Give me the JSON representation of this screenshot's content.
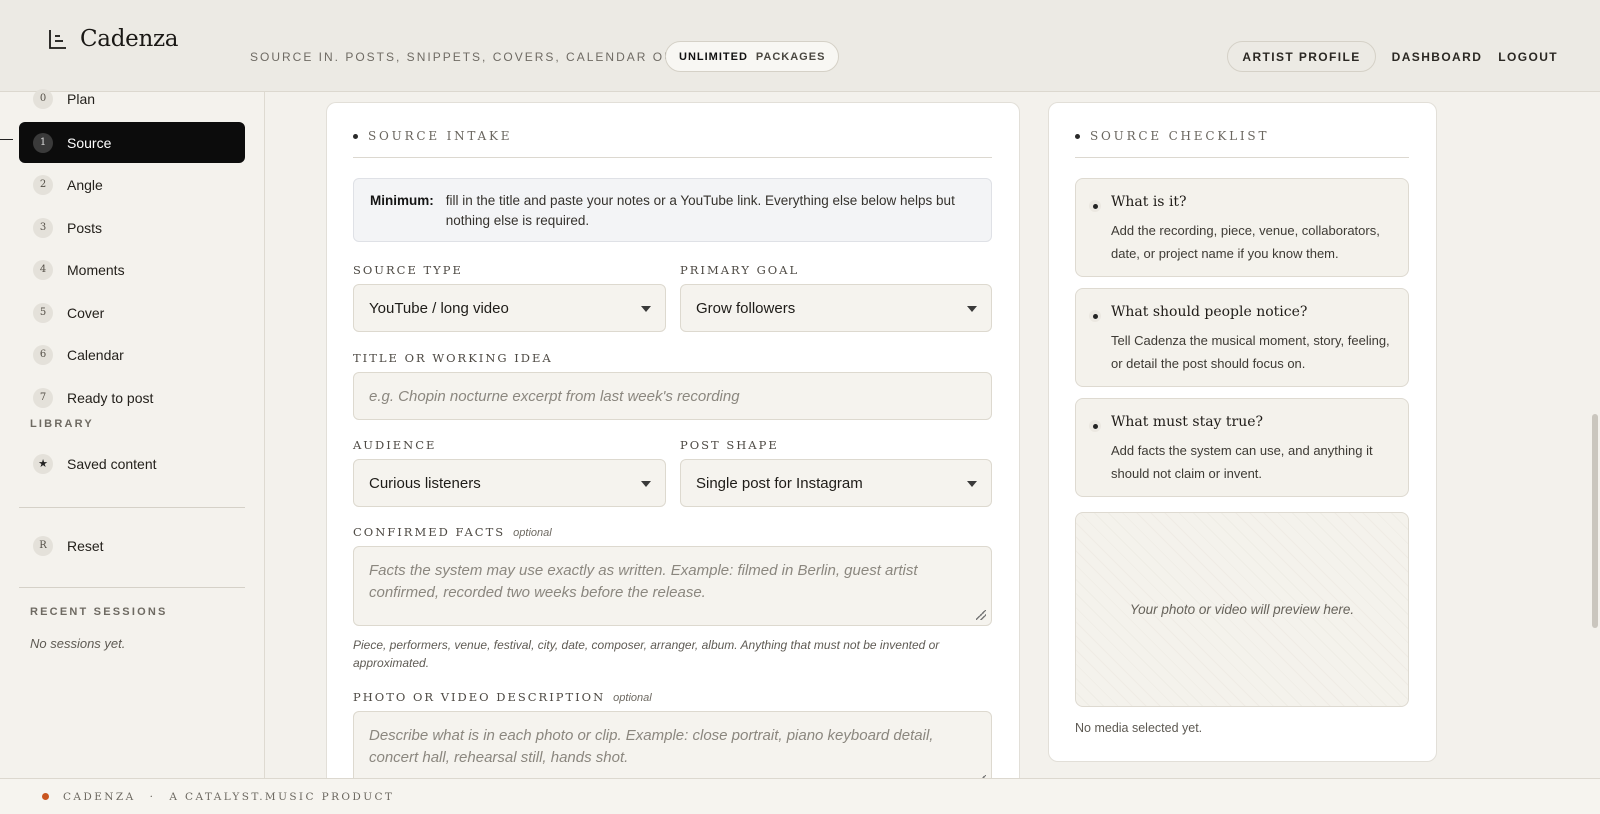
{
  "header": {
    "brand": "Cadenza",
    "tagline": "SOURCE IN. POSTS, SNIPPETS, COVERS, CALENDAR OUT.",
    "plan_pill": {
      "strong": "UNLIMITED",
      "rest": "PACKAGES"
    },
    "nav": {
      "profile": "ARTIST PROFILE",
      "dashboard": "DASHBOARD",
      "logout": "LOGOUT"
    }
  },
  "sidebar": {
    "steps": [
      {
        "num": "0",
        "label": "Plan"
      },
      {
        "num": "1",
        "label": "Source"
      },
      {
        "num": "2",
        "label": "Angle"
      },
      {
        "num": "3",
        "label": "Posts"
      },
      {
        "num": "4",
        "label": "Moments"
      },
      {
        "num": "5",
        "label": "Cover"
      },
      {
        "num": "6",
        "label": "Calendar"
      },
      {
        "num": "7",
        "label": "Ready to post"
      }
    ],
    "active_step": "Source",
    "library_heading": "LIBRARY",
    "saved": {
      "icon": "★",
      "label": "Saved content"
    },
    "reset": {
      "icon": "R",
      "label": "Reset"
    },
    "recent_heading": "RECENT SESSIONS",
    "recent_empty": "No sessions yet."
  },
  "intake": {
    "title": "SOURCE INTAKE",
    "minimum_label": "Minimum:",
    "minimum_text": "fill in the title and paste your notes or a YouTube link. Everything else below helps but nothing else is required.",
    "source_type": {
      "label": "SOURCE TYPE",
      "value": "YouTube / long video"
    },
    "primary_goal": {
      "label": "PRIMARY GOAL",
      "value": "Grow followers"
    },
    "title_field": {
      "label": "TITLE OR WORKING IDEA",
      "placeholder": "e.g. Chopin nocturne excerpt from last week's recording"
    },
    "audience": {
      "label": "AUDIENCE",
      "value": "Curious listeners"
    },
    "post_shape": {
      "label": "POST SHAPE",
      "value": "Single post for Instagram"
    },
    "facts": {
      "label": "CONFIRMED FACTS",
      "optional": "optional",
      "placeholder": "Facts the system may use exactly as written. Example: filmed in Berlin, guest artist confirmed, recorded two weeks before the release.",
      "hint": "Piece, performers, venue, festival, city, date, composer, arranger, album. Anything that must not be invented or approximated."
    },
    "media_desc": {
      "label": "PHOTO OR VIDEO DESCRIPTION",
      "optional": "optional",
      "placeholder": "Describe what is in each photo or clip. Example: close portrait, piano keyboard detail, concert hall, rehearsal still, hands shot."
    }
  },
  "checklist": {
    "title": "SOURCE CHECKLIST",
    "items": [
      {
        "q": "What is it?",
        "d": "Add the recording, piece, venue, collaborators, date, or project name if you know them."
      },
      {
        "q": "What should people notice?",
        "d": "Tell Cadenza the musical moment, story, feeling, or detail the post should focus on."
      },
      {
        "q": "What must stay true?",
        "d": "Add facts the system can use, and anything it should not claim or invent."
      }
    ],
    "preview_text": "Your photo or video will preview here.",
    "media_status": "No media selected yet."
  },
  "footer": {
    "brand": "CADENZA",
    "sep": "·",
    "product": "A CATALYST.MUSIC PRODUCT"
  },
  "colors": {
    "accent": "#c9551f",
    "active_step_bg": "#0c0c0c",
    "page_bg": "#f3f1ec"
  }
}
